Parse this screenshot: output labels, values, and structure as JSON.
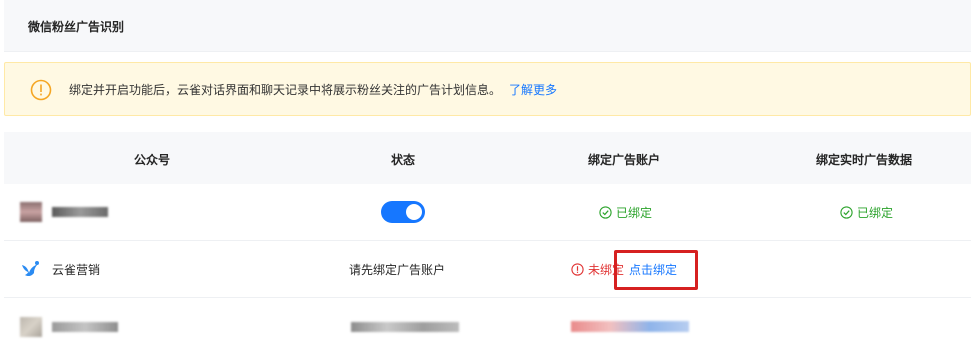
{
  "page_title": "微信粉丝广告识别",
  "notice": {
    "text": "绑定并开启功能后，云雀对话界面和聊天记录中将展示粉丝关注的广告计划信息。",
    "link": "了解更多"
  },
  "table": {
    "headers": [
      "公众号",
      "状态",
      "绑定广告账户",
      "绑定实时广告数据"
    ],
    "rows": [
      {
        "account": "",
        "enabled": true,
        "ad_account_status": "已绑定",
        "realtime_status": "已绑定"
      },
      {
        "account": "云雀营销",
        "state_text": "请先绑定广告账户",
        "ad_account_status": "未绑定",
        "bind_link": "点击绑定"
      },
      {
        "account": "",
        "state_text": "",
        "ad_account_status": ""
      }
    ]
  },
  "colors": {
    "accent": "#1677ff",
    "success": "#2ba32b",
    "error": "#e13333",
    "warning_bg": "#fff9e3",
    "highlight": "#d62020"
  }
}
